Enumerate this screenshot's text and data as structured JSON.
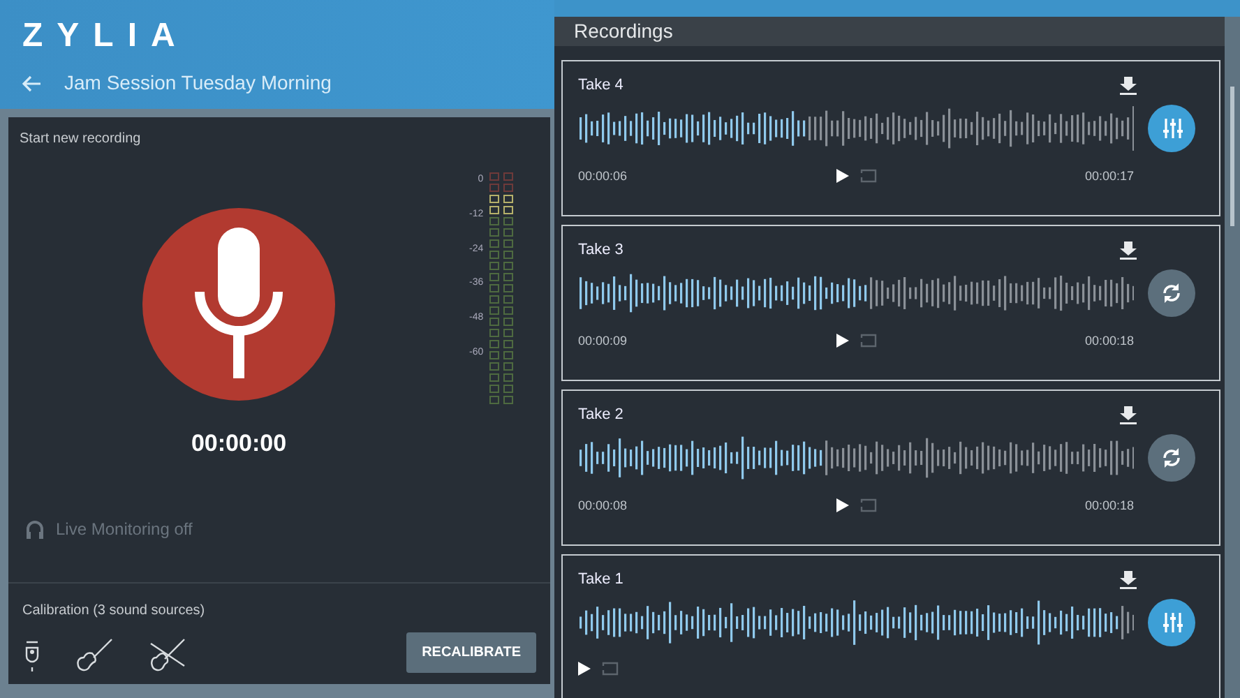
{
  "header": {
    "logo": "ZYLIA",
    "title": "Jam Session Tuesday Morning"
  },
  "recorder": {
    "label": "Start new recording",
    "timer": "00:00:00",
    "meter_scale": [
      "0",
      "-12",
      "-24",
      "-36",
      "-48",
      "-60"
    ],
    "live_monitoring": {
      "label": "Live Monitoring off",
      "disabled": true
    }
  },
  "calibration": {
    "label": "Calibration (3 sound sources)",
    "button": "RECALIBRATE"
  },
  "recordings": {
    "title": "Recordings",
    "takes": [
      {
        "name": "Take 4",
        "position": "00:00:06",
        "duration": "00:00:17",
        "level": 0.41,
        "kind": "mixer"
      },
      {
        "name": "Take 3",
        "position": "00:00:09",
        "duration": "00:00:18",
        "level": 0.52,
        "kind": "process"
      },
      {
        "name": "Take 2",
        "position": "00:00:08",
        "duration": "00:00:18",
        "level": 0.44,
        "kind": "process"
      },
      {
        "name": "Take 1",
        "level": 0.97,
        "kind": "mixer"
      }
    ]
  }
}
